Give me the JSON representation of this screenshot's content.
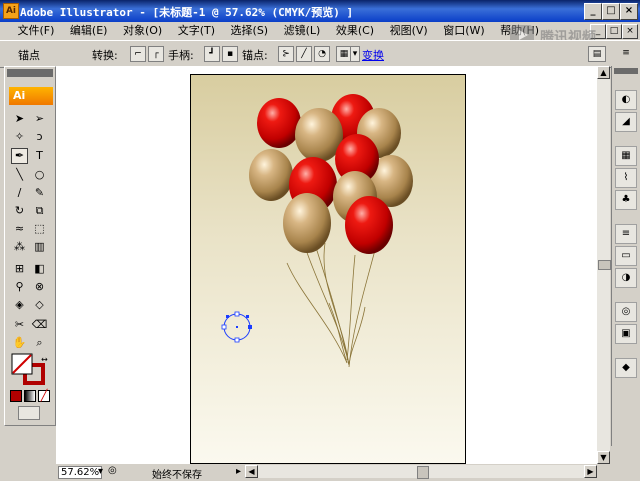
{
  "window": {
    "title": "Adobe Illustrator - [未标题-1 @ 57.62% (CMYK/预览) ]",
    "app_icon_label": "Ai",
    "controls": [
      "_",
      "□",
      "×"
    ]
  },
  "menubar": {
    "items": [
      "文件(F)",
      "编辑(E)",
      "对象(O)",
      "文字(T)",
      "选择(S)",
      "滤镜(L)",
      "效果(C)",
      "视图(V)",
      "窗口(W)",
      "帮助(H)"
    ],
    "doc_controls": [
      "_",
      "□",
      "×"
    ]
  },
  "controlbar": {
    "anchor_label": "锚点",
    "convert_label": "转换:",
    "handles_label": "手柄:",
    "anchors_label": "锚点:",
    "transform_link": "变换"
  },
  "toolbox": {
    "logo": "Ai"
  },
  "statusbar": {
    "zoom": "57.62%",
    "status_text": "始终不保存"
  },
  "watermark": "腾讯视频",
  "colors": {
    "title_bar": "#0a3ec8",
    "artboard_top": "#d8cda0",
    "balloon_red": "#d40a0a",
    "balloon_gold": "#c8a468",
    "selection_blue": "#1a3cff"
  }
}
